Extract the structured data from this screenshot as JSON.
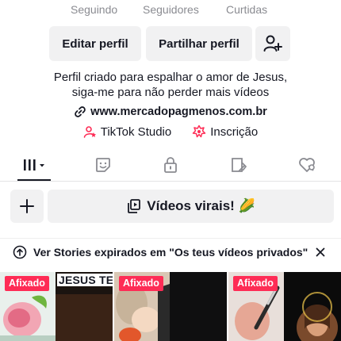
{
  "stats": {
    "following_label": "Seguindo",
    "followers_label": "Seguidores",
    "likes_label": "Curtidas"
  },
  "actions": {
    "edit_profile": "Editar perfil",
    "share_profile": "Partilhar perfil",
    "add_friend_icon": "person-add-icon"
  },
  "bio": {
    "line1": "Perfil criado para espalhar o amor de Jesus,",
    "line2": "siga-me para não perder mais vídeos"
  },
  "link": {
    "icon": "link-icon",
    "url": "www.mercadopagmenos.com.br"
  },
  "tools": {
    "studio_icon": "tiktok-studio-icon",
    "studio_label": "TikTok Studio",
    "subscription_icon": "subscription-icon",
    "subscription_label": "Inscrição"
  },
  "tabs": [
    {
      "name": "videos-grid-icon",
      "active": true
    },
    {
      "name": "reposts-icon",
      "active": false
    },
    {
      "name": "private-lock-icon",
      "active": false
    },
    {
      "name": "favorites-icon",
      "active": false
    },
    {
      "name": "liked-icon",
      "active": false
    }
  ],
  "collections": {
    "add_icon": "plus-icon",
    "playlist_icon": "playlist-icon",
    "playlist_label": "Vídeos virais! 🌽"
  },
  "stories_banner": {
    "icon": "upload-cloud-icon",
    "text": "Ver Stories expirados em \"Os teus vídeos privados\"",
    "close_icon": "close-icon"
  },
  "videos": [
    {
      "badge": "Afixado",
      "overlay": "JESUS TE A"
    },
    {
      "badge": "Afixado",
      "overlay": ""
    },
    {
      "badge": "Afixado",
      "overlay": ""
    }
  ],
  "colors": {
    "accent": "#fe2c55",
    "button_bg": "#f1f1f2",
    "text": "#161823",
    "muted": "#8a8b91"
  }
}
